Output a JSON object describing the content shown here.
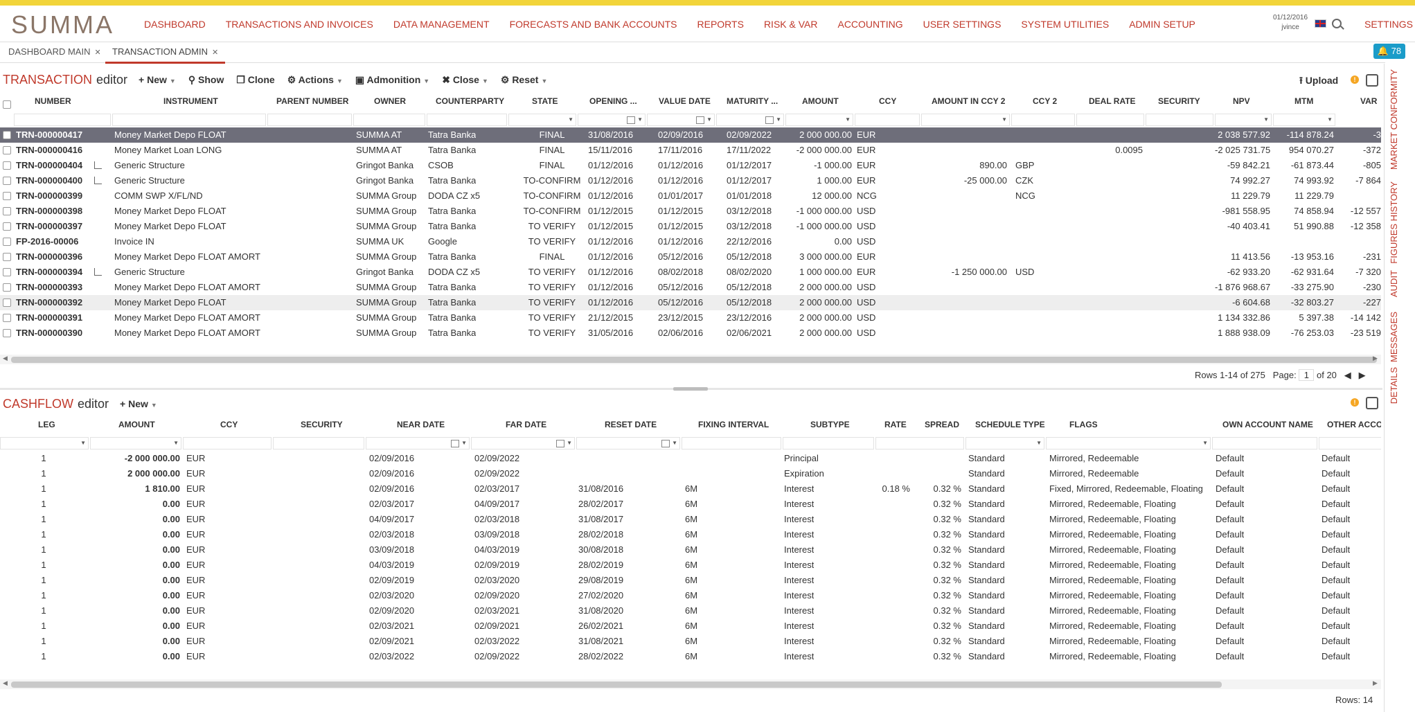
{
  "app": {
    "logo": "SUMMA"
  },
  "nav": [
    "DASHBOARD",
    "TRANSACTIONS AND INVOICES",
    "DATA MANAGEMENT",
    "FORECASTS AND BANK ACCOUNTS",
    "REPORTS",
    "RISK & VAR",
    "ACCOUNTING",
    "USER SETTINGS",
    "SYSTEM UTILITIES",
    "ADMIN SETUP"
  ],
  "user": {
    "date": "01/12/2016",
    "name": "jvince"
  },
  "settings_label": "SETTINGS",
  "tabs": [
    {
      "label": "DASHBOARD MAIN"
    },
    {
      "label": "TRANSACTION ADMIN"
    }
  ],
  "notifications": {
    "count": "78"
  },
  "sidetabs": [
    "MARKET CONFORMITY",
    "FIGURES HISTORY",
    "AUDIT",
    "MESSAGES",
    "DETAILS"
  ],
  "transaction": {
    "title_red": "TRANSACTION",
    "title_dark": "editor",
    "toolbar": [
      "New",
      "Show",
      "Clone",
      "Actions",
      "Admonition",
      "Close",
      "Reset"
    ],
    "upload": "Upload",
    "headers": [
      "NUMBER",
      "INSTRUMENT",
      "PARENT NUMBER",
      "OWNER",
      "COUNTERPARTY",
      "STATE",
      "OPENING ...",
      "VALUE DATE",
      "MATURITY ...",
      "AMOUNT",
      "CCY",
      "AMOUNT IN CCY 2",
      "CCY 2",
      "DEAL RATE",
      "SECURITY",
      "NPV",
      "MTM",
      "VAR"
    ],
    "rows": [
      {
        "number": "TRN-000000417",
        "hier": false,
        "instrument": "Money Market Depo FLOAT",
        "owner": "SUMMA AT",
        "counterparty": "Tatra Banka",
        "state": "FINAL",
        "opening": "31/08/2016",
        "value": "02/09/2016",
        "maturity": "02/09/2022",
        "amount": "2 000 000.00",
        "ccy": "EUR",
        "amt2": "",
        "ccy2": "",
        "rate": "",
        "npv": "2 038 577.92",
        "mtm": "-114 878.24",
        "var": "-3"
      },
      {
        "number": "TRN-000000416",
        "hier": false,
        "instrument": "Money Market Loan LONG",
        "owner": "SUMMA AT",
        "counterparty": "Tatra Banka",
        "state": "FINAL",
        "opening": "15/11/2016",
        "value": "17/11/2016",
        "maturity": "17/11/2022",
        "amount": "-2 000 000.00",
        "ccy": "EUR",
        "amt2": "",
        "ccy2": "",
        "rate": "0.0095",
        "npv": "-2 025 731.75",
        "mtm": "954 070.27",
        "var": "-372"
      },
      {
        "number": "TRN-000000404",
        "hier": true,
        "instrument": "Generic Structure",
        "owner": "Gringot Banka",
        "counterparty": "CSOB",
        "state": "FINAL",
        "opening": "01/12/2016",
        "value": "01/12/2016",
        "maturity": "01/12/2017",
        "amount": "-1 000.00",
        "ccy": "EUR",
        "amt2": "890.00",
        "ccy2": "GBP",
        "rate": "",
        "npv": "-59 842.21",
        "mtm": "-61 873.44",
        "var": "-805"
      },
      {
        "number": "TRN-000000400",
        "hier": true,
        "instrument": "Generic Structure",
        "owner": "Gringot Banka",
        "counterparty": "Tatra Banka",
        "state": "TO-CONFIRM",
        "opening": "01/12/2016",
        "value": "01/12/2016",
        "maturity": "01/12/2017",
        "amount": "1 000.00",
        "ccy": "EUR",
        "amt2": "-25 000.00",
        "ccy2": "CZK",
        "rate": "",
        "npv": "74 992.27",
        "mtm": "74 993.92",
        "var": "-7 864"
      },
      {
        "number": "TRN-000000399",
        "hier": false,
        "instrument": "COMM SWP X/FL/ND",
        "owner": "SUMMA Group",
        "counterparty": "DODA CZ x5",
        "state": "TO-CONFIRM",
        "opening": "01/12/2016",
        "value": "01/01/2017",
        "maturity": "01/01/2018",
        "amount": "12 000.00",
        "ccy": "NCG",
        "amt2": "",
        "ccy2": "NCG",
        "rate": "",
        "npv": "11 229.79",
        "mtm": "11 229.79",
        "var": ""
      },
      {
        "number": "TRN-000000398",
        "hier": false,
        "instrument": "Money Market Depo FLOAT",
        "owner": "SUMMA Group",
        "counterparty": "Tatra Banka",
        "state": "TO-CONFIRM",
        "opening": "01/12/2015",
        "value": "01/12/2015",
        "maturity": "03/12/2018",
        "amount": "-1 000 000.00",
        "ccy": "USD",
        "amt2": "",
        "ccy2": "",
        "rate": "",
        "npv": "-981 558.95",
        "mtm": "74 858.94",
        "var": "-12 557"
      },
      {
        "number": "TRN-000000397",
        "hier": false,
        "instrument": "Money Market Depo FLOAT",
        "owner": "SUMMA Group",
        "counterparty": "Tatra Banka",
        "state": "TO VERIFY",
        "opening": "01/12/2015",
        "value": "01/12/2015",
        "maturity": "03/12/2018",
        "amount": "-1 000 000.00",
        "ccy": "USD",
        "amt2": "",
        "ccy2": "",
        "rate": "",
        "npv": "-40 403.41",
        "mtm": "51 990.88",
        "var": "-12 358"
      },
      {
        "number": "FP-2016-00006",
        "hier": false,
        "instrument": "Invoice IN",
        "owner": "SUMMA UK",
        "counterparty": "Google",
        "state": "TO VERIFY",
        "opening": "01/12/2016",
        "value": "01/12/2016",
        "maturity": "22/12/2016",
        "amount": "0.00",
        "ccy": "USD",
        "amt2": "",
        "ccy2": "",
        "rate": "",
        "npv": "",
        "mtm": "",
        "var": ""
      },
      {
        "number": "TRN-000000396",
        "hier": false,
        "instrument": "Money Market Depo FLOAT AMORT",
        "owner": "SUMMA Group",
        "counterparty": "Tatra Banka",
        "state": "FINAL",
        "opening": "01/12/2016",
        "value": "05/12/2016",
        "maturity": "05/12/2018",
        "amount": "3 000 000.00",
        "ccy": "EUR",
        "amt2": "",
        "ccy2": "",
        "rate": "",
        "npv": "11 413.56",
        "mtm": "-13 953.16",
        "var": "-231"
      },
      {
        "number": "TRN-000000394",
        "hier": true,
        "instrument": "Generic Structure",
        "owner": "Gringot Banka",
        "counterparty": "DODA CZ x5",
        "state": "TO VERIFY",
        "opening": "01/12/2016",
        "value": "08/02/2018",
        "maturity": "08/02/2020",
        "amount": "1 000 000.00",
        "ccy": "EUR",
        "amt2": "-1 250 000.00",
        "ccy2": "USD",
        "rate": "",
        "npv": "-62 933.20",
        "mtm": "-62 931.64",
        "var": "-7 320"
      },
      {
        "number": "TRN-000000393",
        "hier": false,
        "instrument": "Money Market Depo FLOAT AMORT",
        "owner": "SUMMA Group",
        "counterparty": "Tatra Banka",
        "state": "TO VERIFY",
        "opening": "01/12/2016",
        "value": "05/12/2016",
        "maturity": "05/12/2018",
        "amount": "2 000 000.00",
        "ccy": "USD",
        "amt2": "",
        "ccy2": "",
        "rate": "",
        "npv": "-1 876 968.67",
        "mtm": "-33 275.90",
        "var": "-230"
      },
      {
        "number": "TRN-000000392",
        "hier": false,
        "instrument": "Money Market Depo FLOAT",
        "owner": "SUMMA Group",
        "counterparty": "Tatra Banka",
        "state": "TO VERIFY",
        "opening": "01/12/2016",
        "value": "05/12/2016",
        "maturity": "05/12/2018",
        "amount": "2 000 000.00",
        "ccy": "USD",
        "amt2": "",
        "ccy2": "",
        "rate": "",
        "npv": "-6 604.68",
        "mtm": "-32 803.27",
        "var": "-227"
      },
      {
        "number": "TRN-000000391",
        "hier": false,
        "instrument": "Money Market Depo FLOAT AMORT",
        "owner": "SUMMA Group",
        "counterparty": "Tatra Banka",
        "state": "TO VERIFY",
        "opening": "21/12/2015",
        "value": "23/12/2015",
        "maturity": "23/12/2016",
        "amount": "2 000 000.00",
        "ccy": "USD",
        "amt2": "",
        "ccy2": "",
        "rate": "",
        "npv": "1 134 332.86",
        "mtm": "5 397.38",
        "var": "-14 142"
      },
      {
        "number": "TRN-000000390",
        "hier": false,
        "instrument": "Money Market Depo FLOAT AMORT",
        "owner": "SUMMA Group",
        "counterparty": "Tatra Banka",
        "state": "TO VERIFY",
        "opening": "31/05/2016",
        "value": "02/06/2016",
        "maturity": "02/06/2021",
        "amount": "2 000 000.00",
        "ccy": "USD",
        "amt2": "",
        "ccy2": "",
        "rate": "",
        "npv": "1 888 938.09",
        "mtm": "-76 253.03",
        "var": "-23 519"
      }
    ],
    "footer": {
      "rows": "Rows 1-14 of 275",
      "page_label": "Page:",
      "page": "1",
      "of": "of 20"
    }
  },
  "cashflow": {
    "title_red": "CASHFLOW",
    "title_dark": "editor",
    "toolbar": [
      "New"
    ],
    "headers": [
      "LEG",
      "AMOUNT",
      "CCY",
      "SECURITY",
      "NEAR DATE",
      "FAR DATE",
      "RESET DATE",
      "FIXING INTERVAL",
      "SUBTYPE",
      "RATE",
      "SPREAD",
      "SCHEDULE TYPE",
      "FLAGS",
      "OWN ACCOUNT NAME",
      "OTHER ACCOU"
    ],
    "rows": [
      {
        "leg": "1",
        "amount": "-2 000 000.00",
        "ccy": "EUR",
        "near": "02/09/2016",
        "far": "02/09/2022",
        "reset": "",
        "fix": "",
        "subtype": "Principal",
        "rate": "",
        "spread": "",
        "sched": "Standard",
        "flags": "Mirrored, Redeemable",
        "own": "Default",
        "other": "Default"
      },
      {
        "leg": "1",
        "amount": "2 000 000.00",
        "ccy": "EUR",
        "near": "02/09/2016",
        "far": "02/09/2022",
        "reset": "",
        "fix": "",
        "subtype": "Expiration",
        "rate": "",
        "spread": "",
        "sched": "Standard",
        "flags": "Mirrored, Redeemable",
        "own": "Default",
        "other": "Default"
      },
      {
        "leg": "1",
        "amount": "1 810.00",
        "ccy": "EUR",
        "near": "02/09/2016",
        "far": "02/03/2017",
        "reset": "31/08/2016",
        "fix": "6M",
        "subtype": "Interest",
        "rate": "0.18 %",
        "spread": "0.32 %",
        "sched": "Standard",
        "flags": "Fixed, Mirrored, Redeemable, Floating",
        "own": "Default",
        "other": "Default"
      },
      {
        "leg": "1",
        "amount": "0.00",
        "ccy": "EUR",
        "near": "02/03/2017",
        "far": "04/09/2017",
        "reset": "28/02/2017",
        "fix": "6M",
        "subtype": "Interest",
        "rate": "",
        "spread": "0.32 %",
        "sched": "Standard",
        "flags": "Mirrored, Redeemable, Floating",
        "own": "Default",
        "other": "Default"
      },
      {
        "leg": "1",
        "amount": "0.00",
        "ccy": "EUR",
        "near": "04/09/2017",
        "far": "02/03/2018",
        "reset": "31/08/2017",
        "fix": "6M",
        "subtype": "Interest",
        "rate": "",
        "spread": "0.32 %",
        "sched": "Standard",
        "flags": "Mirrored, Redeemable, Floating",
        "own": "Default",
        "other": "Default"
      },
      {
        "leg": "1",
        "amount": "0.00",
        "ccy": "EUR",
        "near": "02/03/2018",
        "far": "03/09/2018",
        "reset": "28/02/2018",
        "fix": "6M",
        "subtype": "Interest",
        "rate": "",
        "spread": "0.32 %",
        "sched": "Standard",
        "flags": "Mirrored, Redeemable, Floating",
        "own": "Default",
        "other": "Default"
      },
      {
        "leg": "1",
        "amount": "0.00",
        "ccy": "EUR",
        "near": "03/09/2018",
        "far": "04/03/2019",
        "reset": "30/08/2018",
        "fix": "6M",
        "subtype": "Interest",
        "rate": "",
        "spread": "0.32 %",
        "sched": "Standard",
        "flags": "Mirrored, Redeemable, Floating",
        "own": "Default",
        "other": "Default"
      },
      {
        "leg": "1",
        "amount": "0.00",
        "ccy": "EUR",
        "near": "04/03/2019",
        "far": "02/09/2019",
        "reset": "28/02/2019",
        "fix": "6M",
        "subtype": "Interest",
        "rate": "",
        "spread": "0.32 %",
        "sched": "Standard",
        "flags": "Mirrored, Redeemable, Floating",
        "own": "Default",
        "other": "Default"
      },
      {
        "leg": "1",
        "amount": "0.00",
        "ccy": "EUR",
        "near": "02/09/2019",
        "far": "02/03/2020",
        "reset": "29/08/2019",
        "fix": "6M",
        "subtype": "Interest",
        "rate": "",
        "spread": "0.32 %",
        "sched": "Standard",
        "flags": "Mirrored, Redeemable, Floating",
        "own": "Default",
        "other": "Default"
      },
      {
        "leg": "1",
        "amount": "0.00",
        "ccy": "EUR",
        "near": "02/03/2020",
        "far": "02/09/2020",
        "reset": "27/02/2020",
        "fix": "6M",
        "subtype": "Interest",
        "rate": "",
        "spread": "0.32 %",
        "sched": "Standard",
        "flags": "Mirrored, Redeemable, Floating",
        "own": "Default",
        "other": "Default"
      },
      {
        "leg": "1",
        "amount": "0.00",
        "ccy": "EUR",
        "near": "02/09/2020",
        "far": "02/03/2021",
        "reset": "31/08/2020",
        "fix": "6M",
        "subtype": "Interest",
        "rate": "",
        "spread": "0.32 %",
        "sched": "Standard",
        "flags": "Mirrored, Redeemable, Floating",
        "own": "Default",
        "other": "Default"
      },
      {
        "leg": "1",
        "amount": "0.00",
        "ccy": "EUR",
        "near": "02/03/2021",
        "far": "02/09/2021",
        "reset": "26/02/2021",
        "fix": "6M",
        "subtype": "Interest",
        "rate": "",
        "spread": "0.32 %",
        "sched": "Standard",
        "flags": "Mirrored, Redeemable, Floating",
        "own": "Default",
        "other": "Default"
      },
      {
        "leg": "1",
        "amount": "0.00",
        "ccy": "EUR",
        "near": "02/09/2021",
        "far": "02/03/2022",
        "reset": "31/08/2021",
        "fix": "6M",
        "subtype": "Interest",
        "rate": "",
        "spread": "0.32 %",
        "sched": "Standard",
        "flags": "Mirrored, Redeemable, Floating",
        "own": "Default",
        "other": "Default"
      },
      {
        "leg": "1",
        "amount": "0.00",
        "ccy": "EUR",
        "near": "02/03/2022",
        "far": "02/09/2022",
        "reset": "28/02/2022",
        "fix": "6M",
        "subtype": "Interest",
        "rate": "",
        "spread": "0.32 %",
        "sched": "Standard",
        "flags": "Mirrored, Redeemable, Floating",
        "own": "Default",
        "other": "Default"
      }
    ],
    "footer": {
      "rows": "Rows: 14"
    }
  },
  "colors": {
    "accent": "#c0392b",
    "selected_row": "#6e6e7a",
    "notification": "#1b9cc9",
    "stripe": "#f2d43a"
  }
}
